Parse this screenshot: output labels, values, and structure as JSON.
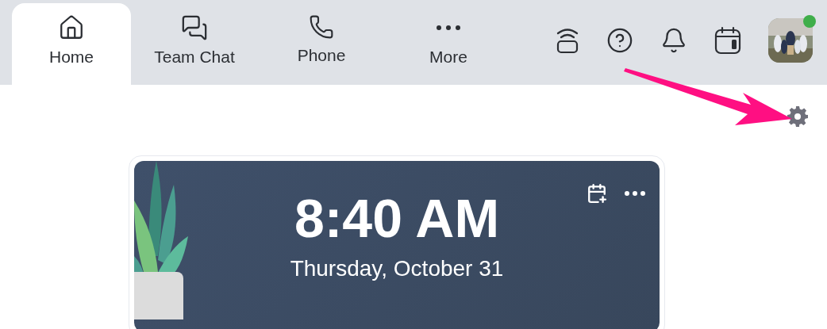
{
  "tabs": [
    {
      "kind": "home",
      "label": "Home",
      "selected": true
    },
    {
      "kind": "chat",
      "label": "Team Chat",
      "selected": false
    },
    {
      "kind": "phone",
      "label": "Phone",
      "selected": false
    },
    {
      "kind": "more",
      "label": "More",
      "selected": false
    }
  ],
  "profile": {
    "online": true
  },
  "clock": {
    "time": "8:40 AM",
    "date": "Thursday, October 31"
  }
}
